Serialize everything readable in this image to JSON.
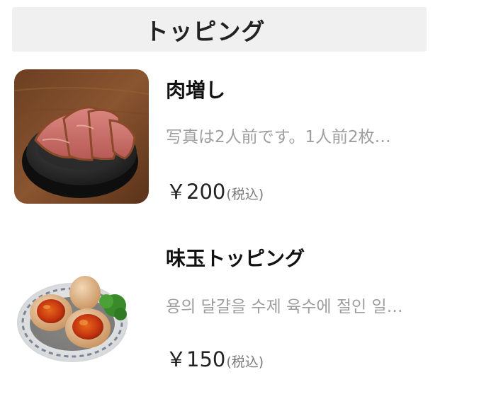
{
  "section": {
    "title": "トッピング"
  },
  "items": [
    {
      "name": "肉増し",
      "description": "写真は2人前です。1人前2枚…",
      "price": "￥200",
      "tax_note": "(税込)",
      "image_icon": "sliced-pork-chashu-photo"
    },
    {
      "name": "味玉トッピング",
      "description": "용의 달걀을 수제 육수에 절인 일…",
      "price": "￥150",
      "tax_note": "(税込)",
      "image_icon": "marinated-egg-photo"
    }
  ]
}
